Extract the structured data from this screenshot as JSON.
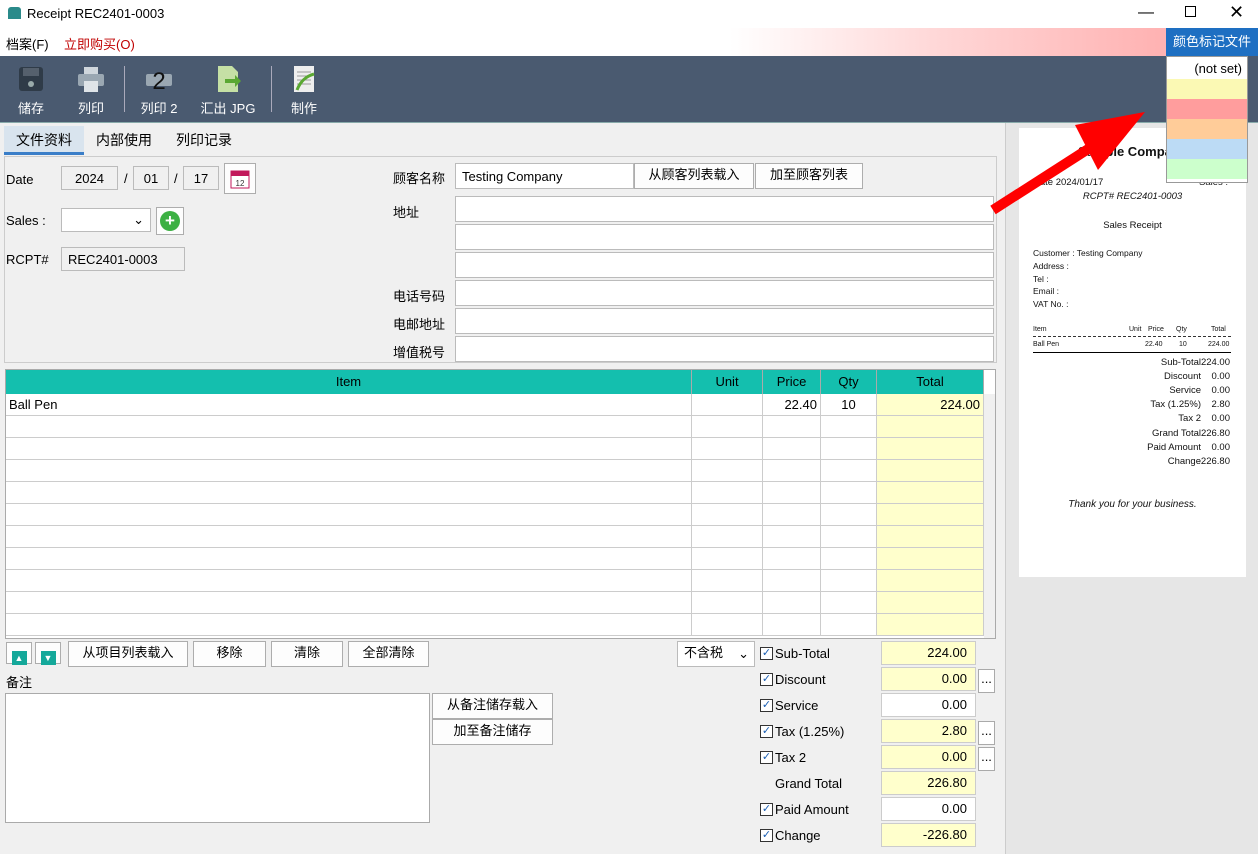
{
  "window": {
    "title": "Receipt REC2401-0003"
  },
  "menu": {
    "file": "档案(F)",
    "buy": "立即购买(O)",
    "color_tag": "颜色标记文件"
  },
  "color_menu": {
    "not_set": "(not set)",
    "colors": [
      "#fbf9b4",
      "#ff9d9d",
      "#ffcc99",
      "#bcdbf5",
      "#ccffcc"
    ]
  },
  "toolbar": {
    "save": "储存",
    "print": "列印",
    "print2": "列印 2",
    "export": "汇出 JPG",
    "make": "制作"
  },
  "tabs": [
    "文件资料",
    "内部使用",
    "列印记录"
  ],
  "form": {
    "date_label": "Date",
    "year": "2024",
    "month": "01",
    "day": "17",
    "sales_label": "Sales :",
    "rcpt_label": "RCPT#",
    "rcpt": "REC2401-0003",
    "customer_label": "顾客名称",
    "customer": "Testing Company",
    "load_customer": "从顾客列表载入",
    "add_customer": "加至顾客列表",
    "address_label": "地址",
    "phone_label": "电话号码",
    "email_label": "电邮地址",
    "vat_label": "增值税号"
  },
  "grid": {
    "headers": [
      "Item",
      "Unit",
      "Price",
      "Qty",
      "Total"
    ],
    "rows": [
      {
        "item": "Ball Pen",
        "unit": "",
        "price": "22.40",
        "qty": "10",
        "total": "224.00"
      }
    ]
  },
  "actions": {
    "load_items": "从项目列表载入",
    "remove": "移除",
    "clear": "清除",
    "clear_all": "全部清除",
    "tax_mode": "不含税"
  },
  "notes": {
    "label": "备注",
    "load": "从备注储存载入",
    "save": "加至备注储存"
  },
  "totals": [
    {
      "label": "Sub-Total",
      "value": "224.00",
      "checked": true
    },
    {
      "label": "Discount",
      "value": "0.00",
      "checked": true
    },
    {
      "label": "Service",
      "value": "0.00",
      "checked": true
    },
    {
      "label": "Tax (1.25%)",
      "value": "2.80",
      "checked": true
    },
    {
      "label": "Tax 2",
      "value": "0.00",
      "checked": true
    },
    {
      "label": "Grand Total",
      "value": "226.80"
    },
    {
      "label": "Paid Amount",
      "value": "0.00",
      "checked": true
    },
    {
      "label": "Change",
      "value": "-226.80",
      "checked": true
    }
  ],
  "preview": {
    "company": "Sample Company",
    "date": "Date 2024/01/17",
    "sales": "Sales :",
    "rcpt": "RCPT# REC2401-0003",
    "doc_title": "Sales Receipt",
    "customer": "Customer : Testing Company",
    "address": "Address :",
    "tel": "Tel :",
    "email": "Email :",
    "vat": "VAT No. :",
    "cols": [
      "Item",
      "Unit",
      "Price",
      "Qty",
      "Total"
    ],
    "row": [
      "Ball Pen",
      "22.40",
      "10",
      "224.00"
    ],
    "totals": [
      [
        "Sub-Total",
        "224.00"
      ],
      [
        "Discount",
        "0.00"
      ],
      [
        "Service",
        "0.00"
      ],
      [
        "Tax (1.25%)",
        "2.80"
      ],
      [
        "Tax 2",
        "0.00"
      ],
      [
        "Grand Total",
        "226.80"
      ],
      [
        "Paid Amount",
        "0.00"
      ],
      [
        "Change",
        "-226.80"
      ]
    ],
    "thanks": "Thank you for your business."
  }
}
